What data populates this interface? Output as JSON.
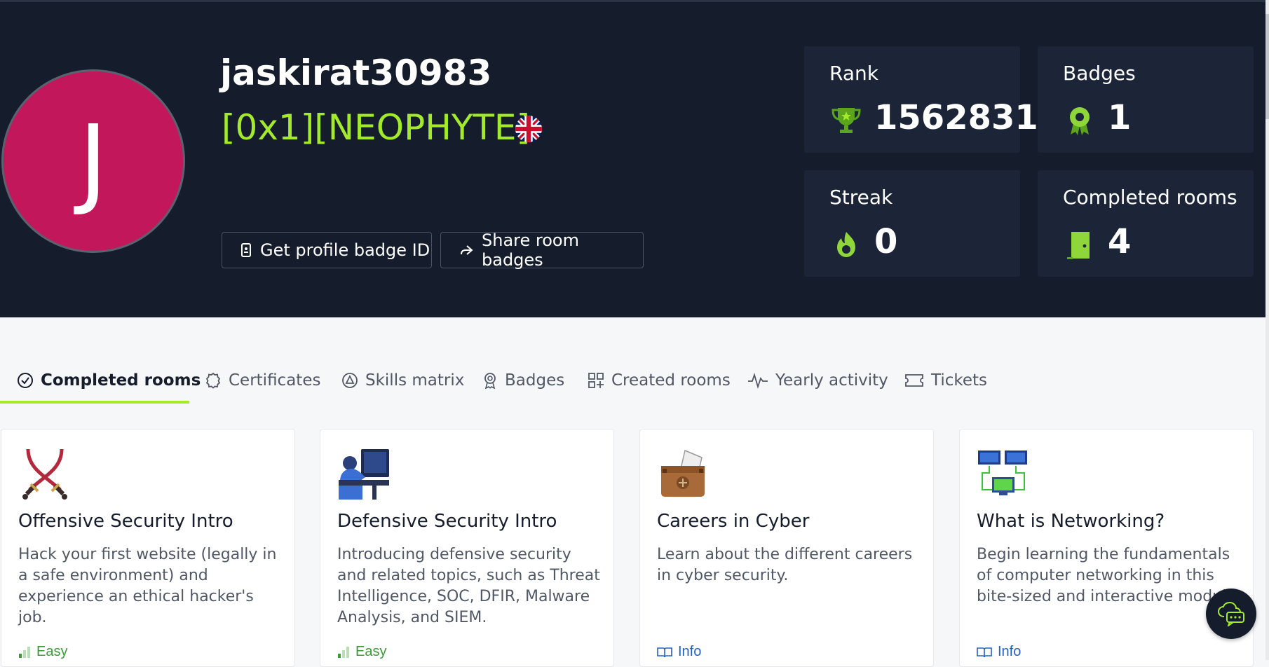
{
  "profile": {
    "initial": "J",
    "username": "jaskirat30983",
    "rank_title": "[0x1][NEOPHYTE]",
    "country_flag_icon": "uk-flag-icon",
    "avatar_color": "#c2185b"
  },
  "actions": {
    "badge_id_label": "Get profile badge ID",
    "share_badges_label": "Share room badges"
  },
  "stats": {
    "rank": {
      "label": "Rank",
      "value": "1562831",
      "icon": "trophy-icon"
    },
    "badges": {
      "label": "Badges",
      "value": "1",
      "icon": "award-icon"
    },
    "streak": {
      "label": "Streak",
      "value": "0",
      "icon": "flame-icon"
    },
    "completed_rooms": {
      "label": "Completed rooms",
      "value": "4",
      "icon": "door-icon"
    }
  },
  "tabs": [
    {
      "label": "Completed rooms",
      "icon": "check-circle-icon",
      "active": true
    },
    {
      "label": "Certificates",
      "icon": "certificate-icon",
      "active": false
    },
    {
      "label": "Skills matrix",
      "icon": "skills-icon",
      "active": false
    },
    {
      "label": "Badges",
      "icon": "badge-icon",
      "active": false
    },
    {
      "label": "Created rooms",
      "icon": "grid-plus-icon",
      "active": false
    },
    {
      "label": "Yearly activity",
      "icon": "activity-icon",
      "active": false
    },
    {
      "label": "Tickets",
      "icon": "ticket-icon",
      "active": false
    }
  ],
  "rooms": [
    {
      "title": "Offensive Security Intro",
      "description": "Hack your first website (legally in a safe environment) and experience an ethical hacker's job.",
      "footer": "Easy",
      "image": "crossed-swords-icon"
    },
    {
      "title": "Defensive Security Intro",
      "description": "Introducing defensive security and related topics, such as Threat Intelligence, SOC, DFIR, Malware Analysis, and SIEM.",
      "footer": "Easy",
      "image": "analyst-desk-icon"
    },
    {
      "title": "Careers in Cyber",
      "description": "Learn about the different careers in cyber security.",
      "footer": "Info",
      "image": "briefcase-icon"
    },
    {
      "title": "What is Networking?",
      "description": "Begin learning the fundamentals of computer networking in this bite-sized and interactive module.",
      "footer": "Info",
      "image": "network-icon"
    }
  ],
  "colors": {
    "hero_bg": "#151c2b",
    "accent_green": "#a3ea2a",
    "stat_card_bg": "#1c2537"
  }
}
